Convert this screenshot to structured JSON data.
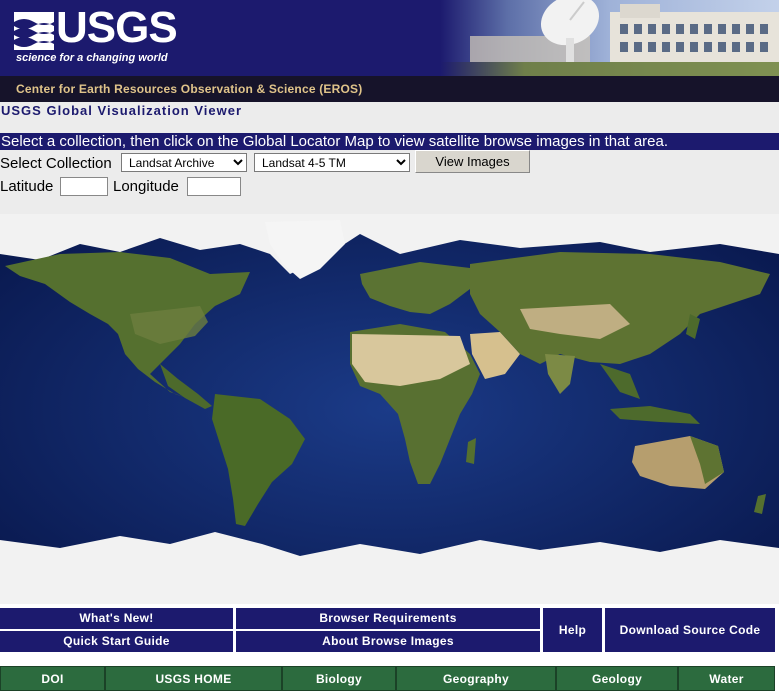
{
  "header": {
    "logo_text": "USGS",
    "tagline": "science for a changing world",
    "center_name": "Center for Earth Resources Observation & Science (EROS)"
  },
  "app": {
    "title": "USGS Global Visualization Viewer",
    "instructions": "Select a collection, then click on the Global Locator Map to view satellite browse images in that area."
  },
  "form": {
    "collection_label": "Select Collection",
    "collection_value": "Landsat Archive",
    "dataset_value": "Landsat 4-5 TM",
    "view_button": "View Images",
    "latitude_label": "Latitude",
    "longitude_label": "Longitude",
    "latitude_value": "",
    "longitude_value": ""
  },
  "nav_links": {
    "whats_new": "What's New!",
    "quick_start": "Quick Start Guide",
    "browser_req": "Browser Requirements",
    "about_browse": "About Browse Images",
    "help": "Help",
    "download_source": "Download Source Code"
  },
  "footer_links": [
    "DOI",
    "USGS HOME",
    "Biology",
    "Geography",
    "Geology",
    "Water"
  ],
  "colors": {
    "navy": "#1c1a6e",
    "green": "#2c6b3e",
    "ocean": "#0b1f5c",
    "land": "#4f6b2c",
    "desert": "#d8c79c",
    "ice": "#f4f4f4"
  }
}
